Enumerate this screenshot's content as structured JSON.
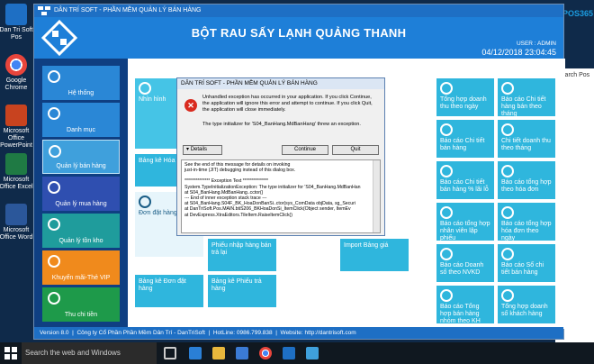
{
  "desktop": {
    "icons": [
      {
        "label": "Dan Tri Soft Pos",
        "color": "#1e6fc4"
      },
      {
        "label": "Google Chrome",
        "color": "#e8453c"
      },
      {
        "label": "Microsoft Office PowerPoint",
        "color": "#c8431f"
      },
      {
        "label": "Microsoft Office Excel",
        "color": "#1f7a44"
      },
      {
        "label": "Microsoft Office Word",
        "color": "#2b579a"
      }
    ]
  },
  "app": {
    "titlebar": "DÂN TRÍ SOFT - PHẦN MỀM QUẢN LÝ BÁN HÀNG",
    "store_title": "BỘT RAU SẤY LẠNH QUẢNG THANH",
    "user": "USER : ADMIN",
    "datetime": "04/12/2018 23:04:45",
    "pos_brand": "POS365",
    "right_search": "Search Pos"
  },
  "sidebar": {
    "items": [
      {
        "label": "Hệ thống",
        "color": "#2a87d6"
      },
      {
        "label": "Danh mục",
        "color": "#2a87d6"
      },
      {
        "label": "Quản lý bán hàng",
        "color": "#3fa0dc"
      },
      {
        "label": "Quản lý mua hàng",
        "color": "#2f4fb0"
      },
      {
        "label": "Quản lý tồn kho",
        "color": "#1f9c9c"
      },
      {
        "label": "Khuyến mãi-Thẻ VIP",
        "color": "#f08a1c"
      },
      {
        "label": "Thu chi tiền",
        "color": "#1e9a4a"
      }
    ]
  },
  "main": {
    "left_tiles": [
      {
        "label": "Nhìn hình"
      },
      {
        "label": "Bảng kê Hóa đơn"
      },
      {
        "label": "Đơn đặt hàng"
      },
      {
        "label": "Phiếu nhập hàng bán trả lại"
      },
      {
        "label": "Import Bảng giá"
      },
      {
        "label": "Bảng kê Đơn đặt hàng"
      },
      {
        "label": "Bảng kê Phiếu trả hàng"
      }
    ],
    "right_tiles": [
      {
        "label": "Tổng hợp doanh thu theo ngày"
      },
      {
        "label": "Báo cáo Chi tiết hàng bán theo tháng"
      },
      {
        "label": "Báo cáo Chi tiết bán hàng"
      },
      {
        "label": "Chi tiết doanh thu theo tháng"
      },
      {
        "label": "Báo cáo Chi tiết bán hàng % lãi lỗ"
      },
      {
        "label": "Báo cáo tổng hợp theo hóa đơn"
      },
      {
        "label": "Báo cáo tổng hợp nhân viên lập phiếu"
      },
      {
        "label": "Báo cáo tổng hợp hóa đơn theo ngày"
      },
      {
        "label": "Báo cáo Doanh số theo NVKD"
      },
      {
        "label": "Báo cáo Sổ chi tiết bán hàng"
      },
      {
        "label": "Báo cáo Tổng hợp bán hàng nhóm theo KH"
      },
      {
        "label": "Tổng hợp doanh số khách hàng"
      }
    ]
  },
  "statusbar": {
    "version": "Version 8.0",
    "company": "Công ty Cổ Phần Phần Mềm Dân Trí - DanTriSoft",
    "hotline": "HotLine: 0986.799.838",
    "website": "Website: http://dantrisoft.com"
  },
  "dialog": {
    "title": "DÂN TRÍ SOFT - PHẦN MỀM QUẢN LÝ BÁN HÀNG",
    "message": "Unhandled exception has occurred in your application. If you click Continue, the application will ignore this error and attempt to continue. If you click Quit, the application will close immediately.",
    "message2": "The type initializer for 'S04_BanHang.MdBanHang' threw an exception.",
    "details_label": "Details",
    "continue_label": "Continue",
    "quit_label": "Quit",
    "details_text": [
      "See the end of this message for details on invoking",
      "just-in-time (JIT) debugging instead of this dialog box.",
      "",
      "************** Exception Text **************",
      "System.TypeInitializationException: The type initializer for 'S04_BanHang.MdBanHan",
      "   at S04_BanHang.MdBanHang..cctor()",
      "   --- End of inner exception stack trace ---",
      "   at S04_BanHang.S04F_BK_HoaDonBanSi..ctor(sys_ComData objData, sg_Securi",
      "   at DanTriSoft.Pos.MAIN.btiS206_BKHoaDonSi_ItemClick(Object sender, ItemEv",
      "   at DevExpress.XtraEditors.TileItem.RaiseItemClick()"
    ]
  },
  "taskbar": {
    "search_placeholder": "Search the web and Windows"
  }
}
